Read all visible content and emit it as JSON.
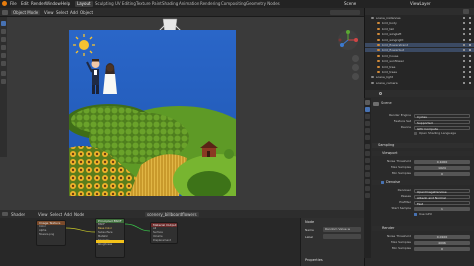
{
  "menubar": {
    "menus": [
      "File",
      "Edit",
      "Render",
      "Window",
      "Help"
    ],
    "workspaces": [
      "Layout",
      "Sculpting",
      "UV Editing",
      "Texture Paint",
      "Shading",
      "Animation",
      "Rendering",
      "Compositing",
      "Geometry Nodes"
    ],
    "active_workspace": "Layout",
    "scene_label": "Scene",
    "layer_label": "ViewLayer"
  },
  "viewport_header": {
    "mode": "Object Mode",
    "menus": [
      "View",
      "Select",
      "Add",
      "Object"
    ]
  },
  "outliner": {
    "items": [
      {
        "name": "scene_instances",
        "indent": 1,
        "color": "#8a8a8a",
        "sel": false
      },
      {
        "name": "bird_body",
        "indent": 2,
        "color": "#d28b3a",
        "sel": false
      },
      {
        "name": "bird_tail",
        "indent": 2,
        "color": "#d28b3a",
        "sel": false
      },
      {
        "name": "bird_wingleft",
        "indent": 2,
        "color": "#d28b3a",
        "sel": false
      },
      {
        "name": "bird_wingright",
        "indent": 2,
        "color": "#d28b3a",
        "sel": false
      },
      {
        "name": "bird_flowerstrand",
        "indent": 2,
        "color": "#d28b3a",
        "sel": true
      },
      {
        "name": "bird_flowerbud",
        "indent": 2,
        "color": "#d28b3a",
        "sel": true
      },
      {
        "name": "bird_house",
        "indent": 2,
        "color": "#d28b3a",
        "sel": false
      },
      {
        "name": "bird_sunflower",
        "indent": 2,
        "color": "#d28b3a",
        "sel": false
      },
      {
        "name": "bird_tree",
        "indent": 2,
        "color": "#d28b3a",
        "sel": false
      },
      {
        "name": "bird_trees",
        "indent": 2,
        "color": "#d28b3a",
        "sel": false
      },
      {
        "name": "scene_light",
        "indent": 1,
        "color": "#8a8a8a",
        "sel": false
      },
      {
        "name": "scene_camera",
        "indent": 1,
        "color": "#8a8a8a",
        "sel": false
      }
    ]
  },
  "properties": {
    "object_name": "Scene",
    "render_engine_label": "Render Engine",
    "render_engine": "Cycles",
    "feature_set_label": "Feature Set",
    "feature_set": "Supported",
    "device_label": "Device",
    "device": "GPU Compute",
    "osl_label": "Open Shading Language",
    "sampling_title": "Sampling",
    "viewport_title": "Viewport",
    "noise_threshold_label": "Noise Threshold",
    "noise_threshold_vp": "0.1000",
    "max_samples_label": "Max Samples",
    "max_samples_vp": "1024",
    "min_samples_label": "Min Samples",
    "min_samples_vp": "0",
    "denoise_title": "Denoise",
    "denoiser_label": "Denoiser",
    "denoiser_vp": "OpenImageDenoise",
    "passes_label": "Passes",
    "passes_vp": "Albedo and Normal",
    "prefilter_label": "Prefilter",
    "prefilter_vp": "Fast",
    "start_sample_label": "Start Sample",
    "start_sample_vp": "1",
    "use_gpu_label": "Use GPU",
    "render_title": "Render",
    "noise_threshold_r": "0.0100",
    "max_samples_r": "4096",
    "min_samples_r": "0"
  },
  "bottom": {
    "editor": "Shader",
    "menus": [
      "View",
      "Select",
      "Add",
      "Node"
    ],
    "material": "scenery_billboardflowers",
    "nodes": [
      {
        "title": "Image Texture",
        "rows": [
          "Color",
          "Alpha",
          "flowers.png"
        ]
      },
      {
        "title": "Principled BSDF",
        "rows": [
          "BSDF",
          "Base Color",
          "Subsurface",
          "Metallic",
          "Specular",
          "Roughness"
        ]
      },
      {
        "title": "Material Output",
        "rows": [
          "All",
          "Surface",
          "Volume",
          "Displacement"
        ]
      }
    ],
    "npanel_title": "Node",
    "npanel_name_label": "Name",
    "npanel_name": "Random Value.w",
    "npanel_label_label": "Label",
    "npanel_properties": "Properties"
  },
  "colors": {
    "accent": "#4772b3",
    "selected_row": "#3b4a63",
    "sky": "#2f6fd1"
  }
}
